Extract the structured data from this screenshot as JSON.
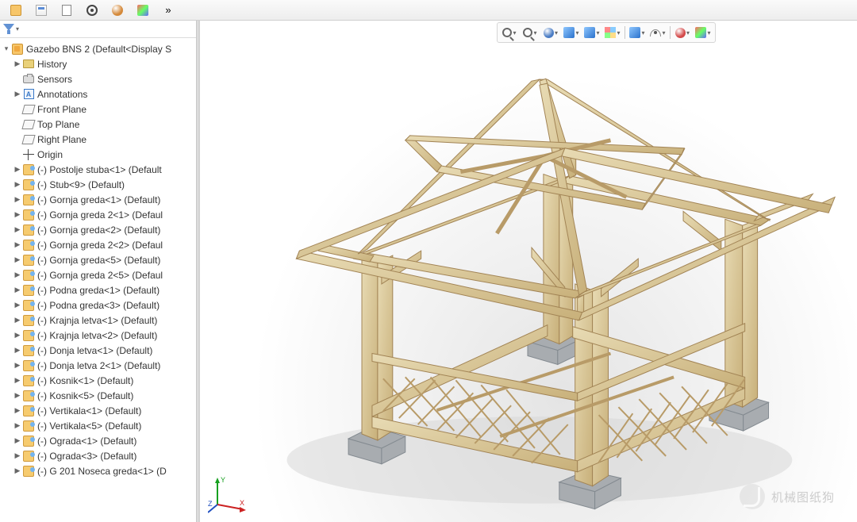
{
  "top_toolbar": {
    "buttons": [
      {
        "name": "assembly-icon",
        "glyph": "asm"
      },
      {
        "name": "prop-icon",
        "glyph": "prop"
      },
      {
        "name": "doc-icon",
        "glyph": "doc"
      },
      {
        "name": "target-icon",
        "glyph": "target"
      },
      {
        "name": "appearance-icon",
        "glyph": "sphere"
      },
      {
        "name": "palette-icon",
        "glyph": "pal"
      }
    ],
    "overflow": "»"
  },
  "filter_label": "",
  "tree": {
    "root": {
      "label": "Gazebo BNS 2  (Default<Display S",
      "icon": "asm"
    },
    "items": [
      {
        "label": "History",
        "icon": "folder",
        "expander": "▶"
      },
      {
        "label": "Sensors",
        "icon": "camera",
        "expander": ""
      },
      {
        "label": "Annotations",
        "icon": "ann",
        "expander": "▶"
      },
      {
        "label": "Front Plane",
        "icon": "plane",
        "expander": ""
      },
      {
        "label": "Top Plane",
        "icon": "plane",
        "expander": ""
      },
      {
        "label": "Right Plane",
        "icon": "plane",
        "expander": ""
      },
      {
        "label": "Origin",
        "icon": "origin",
        "expander": ""
      },
      {
        "label": "(-) Postolje stuba<1> (Default",
        "icon": "part",
        "expander": "▶"
      },
      {
        "label": "(-) Stub<9> (Default)",
        "icon": "part",
        "expander": "▶"
      },
      {
        "label": "(-) Gornja greda<1> (Default)",
        "icon": "part",
        "expander": "▶"
      },
      {
        "label": "(-) Gornja greda 2<1> (Defaul",
        "icon": "part",
        "expander": "▶"
      },
      {
        "label": "(-) Gornja greda<2> (Default)",
        "icon": "part",
        "expander": "▶"
      },
      {
        "label": "(-) Gornja greda 2<2> (Defaul",
        "icon": "part",
        "expander": "▶"
      },
      {
        "label": "(-) Gornja greda<5> (Default)",
        "icon": "part",
        "expander": "▶"
      },
      {
        "label": "(-) Gornja greda 2<5> (Defaul",
        "icon": "part",
        "expander": "▶"
      },
      {
        "label": "(-) Podna greda<1> (Default)",
        "icon": "part",
        "expander": "▶"
      },
      {
        "label": "(-) Podna greda<3> (Default)",
        "icon": "part",
        "expander": "▶"
      },
      {
        "label": "(-) Krajnja letva<1> (Default)",
        "icon": "part",
        "expander": "▶"
      },
      {
        "label": "(-) Krajnja letva<2> (Default)",
        "icon": "part",
        "expander": "▶"
      },
      {
        "label": "(-) Donja letva<1> (Default)",
        "icon": "part",
        "expander": "▶"
      },
      {
        "label": "(-) Donja letva 2<1> (Default)",
        "icon": "part",
        "expander": "▶"
      },
      {
        "label": "(-) Kosnik<1> (Default)",
        "icon": "part",
        "expander": "▶"
      },
      {
        "label": "(-) Kosnik<5> (Default)",
        "icon": "part",
        "expander": "▶"
      },
      {
        "label": "(-) Vertikala<1> (Default)",
        "icon": "part",
        "expander": "▶"
      },
      {
        "label": "(-) Vertikala<5> (Default)",
        "icon": "part",
        "expander": "▶"
      },
      {
        "label": "(-) Ograda<1> (Default)",
        "icon": "part",
        "expander": "▶"
      },
      {
        "label": "(-) Ograda<3> (Default)",
        "icon": "part",
        "expander": "▶"
      },
      {
        "label": "(-) G 201 Noseca greda<1> (D",
        "icon": "part",
        "expander": "▶"
      }
    ]
  },
  "view_toolbar": {
    "buttons": [
      {
        "name": "zoom-fit-icon",
        "glyph": "search"
      },
      {
        "name": "zoom-area-icon",
        "glyph": "search"
      },
      {
        "name": "rotate-icon",
        "glyph": "sphere2"
      },
      {
        "name": "section-icon",
        "glyph": "cubes"
      },
      {
        "name": "section2-icon",
        "glyph": "cubes"
      },
      {
        "name": "display-style-icon",
        "glyph": "multicube"
      },
      {
        "name": "sep"
      },
      {
        "name": "render-style-icon",
        "glyph": "cubes"
      },
      {
        "name": "hide-show-icon",
        "glyph": "eye"
      },
      {
        "name": "sep"
      },
      {
        "name": "appearance-icon",
        "glyph": "sphere-color"
      },
      {
        "name": "scene-icon",
        "glyph": "pal"
      }
    ]
  },
  "triad": {
    "x": "X",
    "y": "Y",
    "z": "Z"
  },
  "watermark": "机械图纸狗",
  "colors": {
    "wood_light": "#e4d3a7",
    "wood_dark": "#c0a76f",
    "wood_edge": "#a08050",
    "footer": "#9aa2a8"
  }
}
